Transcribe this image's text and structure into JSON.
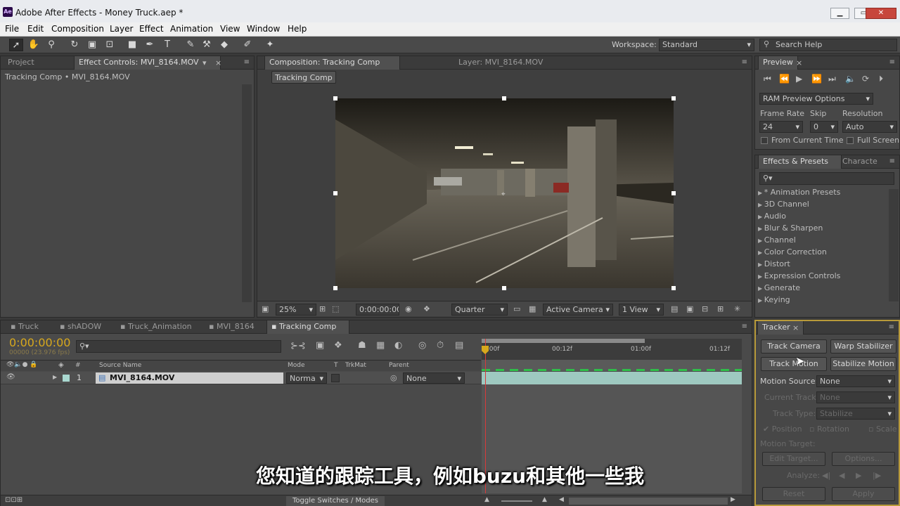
{
  "window": {
    "title": "Adobe After Effects - Money Truck.aep *",
    "app_icon": "Ae"
  },
  "menu": [
    "File",
    "Edit",
    "Composition",
    "Layer",
    "Effect",
    "Animation",
    "View",
    "Window",
    "Help"
  ],
  "toolbar": {
    "workspace_label": "Workspace:",
    "workspace_value": "Standard",
    "search_help": "Search Help"
  },
  "project_panel": {
    "tab_project": "Project",
    "tab_effect_controls": "Effect Controls: MVI_8164.MOV",
    "breadcrumb": "Tracking Comp • MVI_8164.MOV"
  },
  "comp_panel": {
    "tab_comp": "Composition: Tracking Comp",
    "tab_layer": "Layer: MVI_8164.MOV",
    "comp_button": "Tracking Comp",
    "zoom": "25%",
    "timecode": "0:00:00:00",
    "resolution": "Quarter",
    "camera": "Active Camera",
    "views": "1 View"
  },
  "preview_panel": {
    "title": "Preview",
    "ram_options": "RAM Preview Options",
    "frame_rate_label": "Frame Rate",
    "skip_label": "Skip",
    "resolution_label": "Resolution",
    "frame_rate": "24",
    "skip": "0",
    "resolution": "Auto",
    "from_current_time": "From Current Time",
    "full_screen": "Full Screen"
  },
  "effects_panel": {
    "tab_effects": "Effects & Presets",
    "tab_character": "Characte",
    "items": [
      "* Animation Presets",
      "3D Channel",
      "Audio",
      "Blur & Sharpen",
      "Channel",
      "Color Correction",
      "Distort",
      "Expression Controls",
      "Generate",
      "Keying"
    ]
  },
  "timeline": {
    "tabs": [
      "Truck",
      "shADOW",
      "Truck_Animation",
      "MVI_8164",
      "Tracking Comp"
    ],
    "timecode": "0:00:00:00",
    "frames_fps": "00000 (23.976 fps)",
    "col_source": "Source Name",
    "col_mode": "Mode",
    "col_t": "T",
    "col_trkmat": "TrkMat",
    "col_parent": "Parent",
    "layer_num": "1",
    "layer_name": "MVI_8164.MOV",
    "layer_mode": "Norma",
    "layer_parent": "None",
    "ruler": [
      "0:00f",
      "00:12f",
      "01:00f",
      "01:12f"
    ],
    "toggle": "Toggle Switches / Modes"
  },
  "tracker": {
    "title": "Tracker",
    "track_camera": "Track Camera",
    "warp_stabilizer": "Warp Stabilizer",
    "track_motion": "Track Motion",
    "stabilize_motion": "Stabilize Motion",
    "motion_source_label": "Motion Source:",
    "motion_source": "None",
    "current_track_label": "Current Track:",
    "current_track": "None",
    "track_type_label": "Track Type:",
    "track_type": "Stabilize",
    "position": "Position",
    "rotation": "Rotation",
    "scale": "Scale",
    "motion_target": "Motion Target:",
    "edit_target": "Edit Target...",
    "options": "Options...",
    "analyze": "Analyze:",
    "reset": "Reset",
    "apply": "Apply"
  },
  "subtitle": "您知道的跟踪工具，例如buzu和其他一些我",
  "colors": {
    "timecode": "#d7a81d",
    "layer_bar": "#9ec9c0",
    "playhead": "#d83a3a",
    "accent_blue": "#3b6fb5"
  }
}
